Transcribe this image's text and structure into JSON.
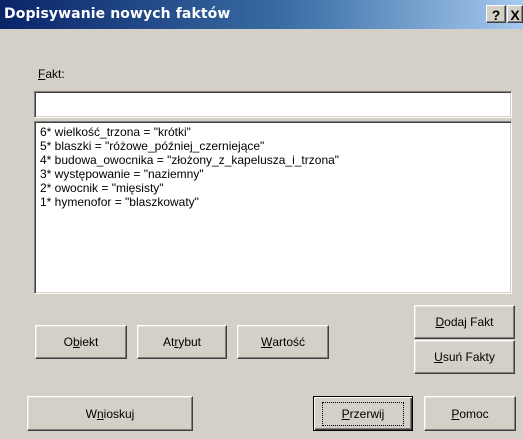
{
  "window": {
    "title": "Dopisywanie nowych faktów",
    "help_button": "?",
    "close_button": "X"
  },
  "fakt": {
    "label_mnemonic": "F",
    "label_rest": "akt:",
    "value": ""
  },
  "facts": [
    "6* wielkość_trzona = \"krótki\"",
    "5* blaszki = \"różowe_później_czerniejące\"",
    "4* budowa_owocnika = \"złożony_z_kapelusza_i_trzona\"",
    "3* występowanie = \"naziemny\"",
    "2* owocnik = \"mięsisty\"",
    "1* hymenofor = \"blaszkowaty\""
  ],
  "buttons": {
    "obiekt": {
      "pre": "O",
      "u": "b",
      "post": "iekt"
    },
    "atrybut": {
      "pre": "At",
      "u": "r",
      "post": "ybut"
    },
    "wartosc": {
      "pre": "",
      "u": "W",
      "post": "artość"
    },
    "dodaj": {
      "pre": "",
      "u": "D",
      "post": "odaj Fakt"
    },
    "usun": {
      "pre": "",
      "u": "U",
      "post": "suń Fakty"
    },
    "wnioskuj": {
      "pre": "W",
      "u": "n",
      "post": "ioskuj"
    },
    "przerwij": {
      "pre": "",
      "u": "P",
      "post": "rzerwij"
    },
    "pomoc": {
      "pre": "",
      "u": "P",
      "post": "omoc"
    }
  }
}
